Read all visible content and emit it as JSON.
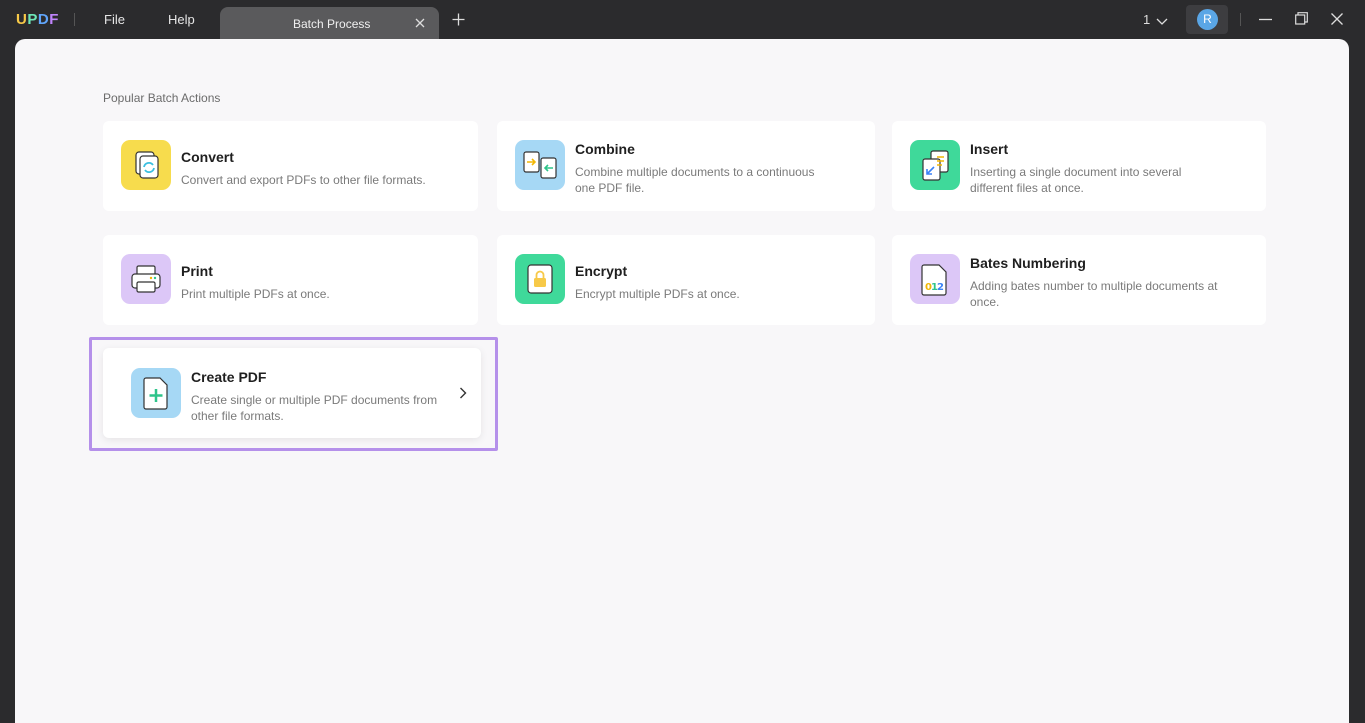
{
  "app": {
    "logo": [
      "U",
      "P",
      "D",
      "F"
    ]
  },
  "menu": {
    "file": "File",
    "help": "Help"
  },
  "tab": {
    "label": "Batch Process",
    "close_icon": "close-icon",
    "new_tab_icon": "plus-icon"
  },
  "header": {
    "page_count": "1",
    "avatar_initial": "R"
  },
  "section": {
    "title": "Popular Batch Actions"
  },
  "actions": [
    {
      "id": "convert",
      "title": "Convert",
      "desc": "Convert and export PDFs to other file formats.",
      "icon": "convert-icon",
      "color": "#f7dc4d"
    },
    {
      "id": "combine",
      "title": "Combine",
      "desc": "Combine multiple documents to a continuous one PDF file.",
      "icon": "combine-icon",
      "color": "#a6d8f5"
    },
    {
      "id": "insert",
      "title": "Insert",
      "desc": "Inserting a single document into several different files at once.",
      "icon": "insert-icon",
      "color": "#3fd99a"
    },
    {
      "id": "print",
      "title": "Print",
      "desc": "Print multiple PDFs at once.",
      "icon": "printer-icon",
      "color": "#dcc7f7"
    },
    {
      "id": "encrypt",
      "title": "Encrypt",
      "desc": "Encrypt multiple PDFs at once.",
      "icon": "lock-icon",
      "color": "#3fd99a"
    },
    {
      "id": "bates",
      "title": "Bates Numbering",
      "desc": "Adding bates number to multiple documents at once.",
      "icon": "bates-number-icon",
      "color": "#dcc7f7"
    },
    {
      "id": "create",
      "title": "Create PDF",
      "desc": "Create single or multiple PDF documents from other file formats.",
      "icon": "create-pdf-icon",
      "color": "#a6d8f5"
    }
  ],
  "colors": {
    "highlight": "#b590ea",
    "background": "#2b2b2d",
    "panel": "#f8f7f9"
  }
}
